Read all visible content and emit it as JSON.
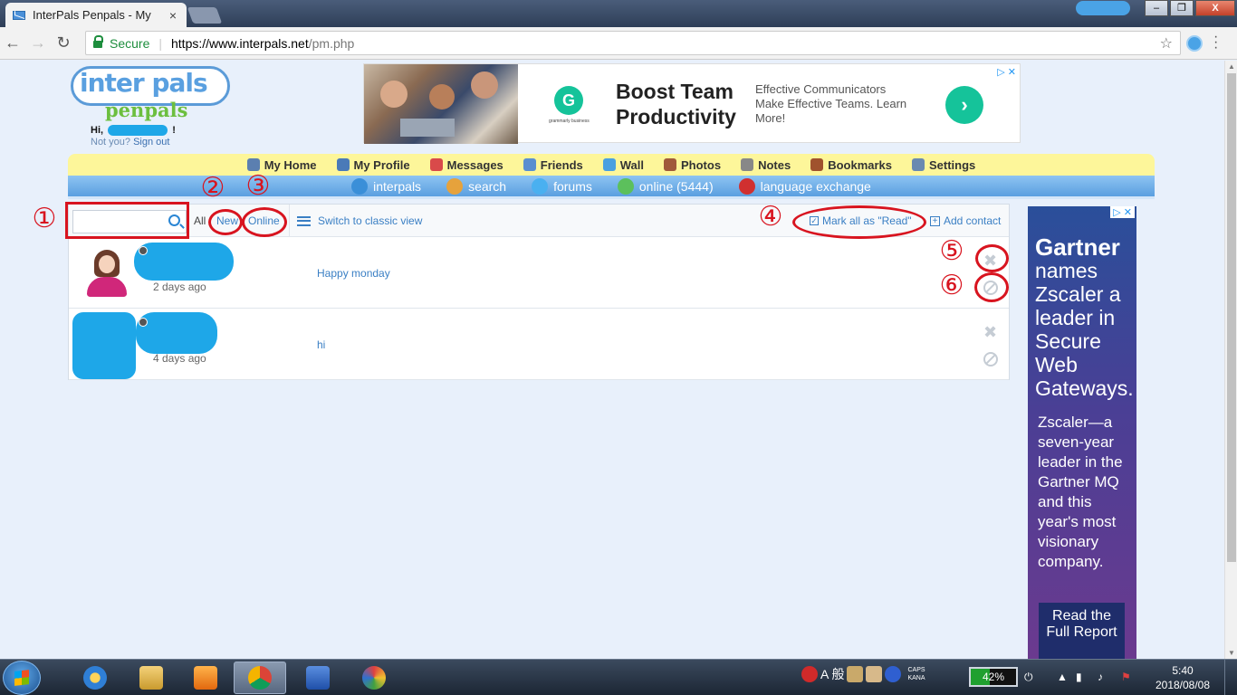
{
  "browser": {
    "tab_title": "InterPals Penpals - My",
    "tab_close": "×",
    "secure_label": "Secure",
    "url_host": "https://www.interpals.net",
    "url_path": "/pm.php",
    "window_close": "X"
  },
  "header": {
    "logo_top": "inter pals",
    "logo_bottom": "penpals",
    "greeting_prefix": "Hi,",
    "greeting_suffix": "!",
    "not_you": "Not you?",
    "sign_out": "Sign out"
  },
  "ad_banner": {
    "headline": "Boost Team Productivity",
    "body": "Effective Communicators Make Effective Teams. Learn More!",
    "logo_letter": "G",
    "logo_sub": "grammarly business",
    "cta": "›",
    "choices": "▷ ✕"
  },
  "topnav": {
    "items": [
      {
        "label": "My Home",
        "color": "#5b7fb0"
      },
      {
        "label": "My Profile",
        "color": "#4a7ab8"
      },
      {
        "label": "Messages",
        "color": "#d94a4a"
      },
      {
        "label": "Friends",
        "color": "#5a8fd0"
      },
      {
        "label": "Wall",
        "color": "#4aa0e0"
      },
      {
        "label": "Photos",
        "color": "#a05a3a"
      },
      {
        "label": "Notes",
        "color": "#888888"
      },
      {
        "label": "Bookmarks",
        "color": "#a0522d"
      },
      {
        "label": "Settings",
        "color": "#6a8ab0"
      }
    ]
  },
  "subnav": {
    "items": [
      {
        "label": "interpals",
        "color": "#3a8fd8"
      },
      {
        "label": "search",
        "color": "#e6a23c"
      },
      {
        "label": "forums",
        "color": "#4ab0f0"
      },
      {
        "label": "online (5444)",
        "color": "#5cc05c"
      },
      {
        "label": "language exchange",
        "color": "#d03030"
      }
    ]
  },
  "toolbar": {
    "search_placeholder": "",
    "filter_all": "All",
    "filter_new": "New",
    "filter_online": "Online",
    "classic_view": "Switch to classic view",
    "mark_all_read": "Mark all as \"Read\"",
    "add_contact": "Add contact"
  },
  "messages": [
    {
      "time": "2 days ago",
      "preview": "Happy monday"
    },
    {
      "time": "4 days ago",
      "preview": "hi"
    }
  ],
  "annotations": {
    "n1": "①",
    "n2": "②",
    "n3": "③",
    "n4": "④",
    "n5": "⑤",
    "n6": "⑥"
  },
  "sky_ad": {
    "choices": "▷ ✕",
    "brand": "Gartner",
    "headline": "names Zscaler a leader in Secure Web Gateways.",
    "body": "Zscaler—a seven-year leader in the Gartner MQ and this year's most visionary company.",
    "cta": "Read the Full Report"
  },
  "taskbar": {
    "ime_label": "A 般",
    "caps": "CAPS",
    "kana": "KANA",
    "battery_percent": 42,
    "battery_label": "42%",
    "time": "5:40",
    "date": "2018/08/08"
  }
}
